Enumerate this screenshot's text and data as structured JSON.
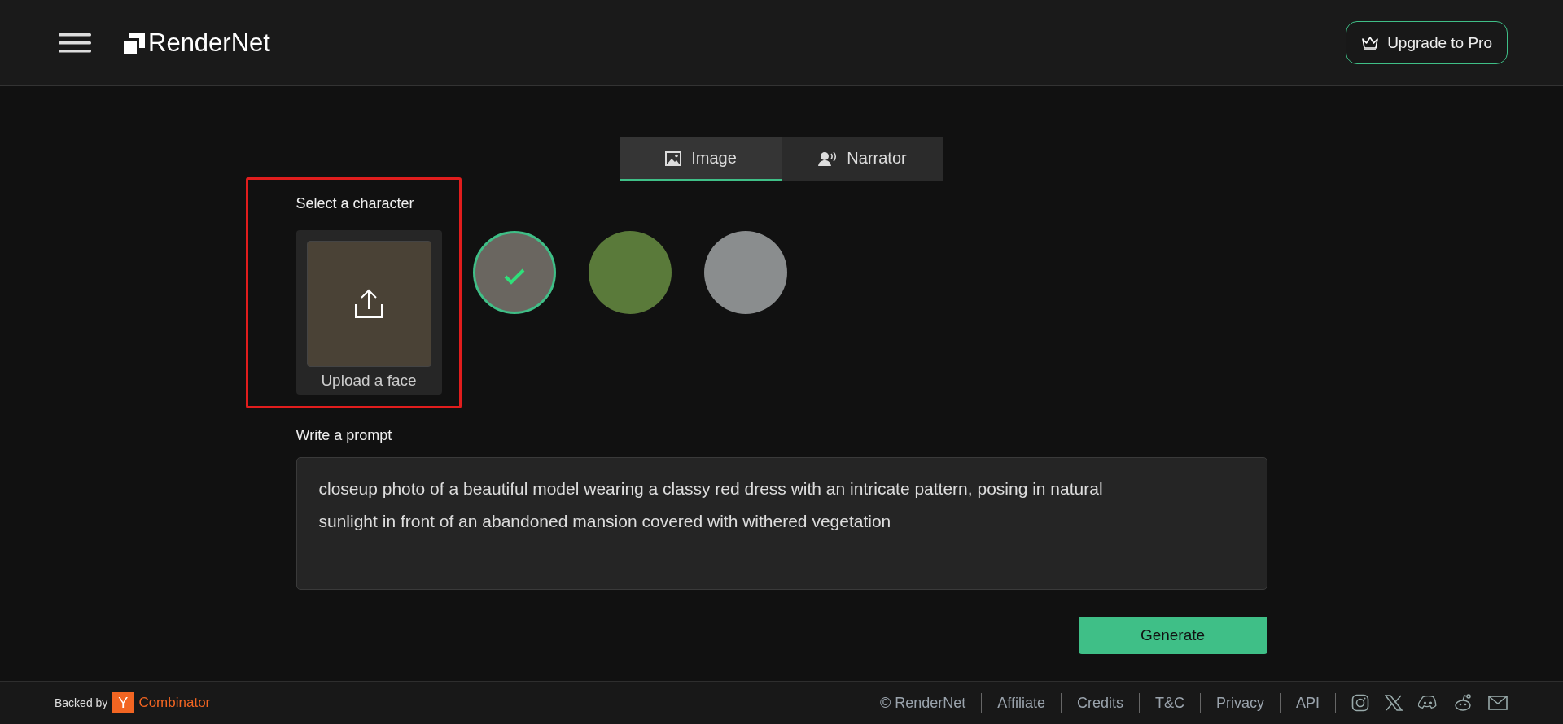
{
  "header": {
    "brand": "RenderNet",
    "upgrade_button": "Upgrade to Pro"
  },
  "tabs": [
    {
      "label": "Image",
      "selected": true
    },
    {
      "label": "Narrator",
      "selected": false
    }
  ],
  "character_section": {
    "label": "Select a character",
    "upload_label": "Upload a face",
    "characters": [
      {
        "selected": true
      },
      {
        "selected": false
      },
      {
        "selected": false
      }
    ]
  },
  "prompt": {
    "label": "Write a prompt",
    "value": "closeup photo of a beautiful model wearing a classy red dress with an intricate pattern, posing in natural sunlight in front of an abandoned mansion covered with withered vegetation"
  },
  "generate_button": "Generate",
  "footer": {
    "backed_by": "Backed by",
    "yc_mark": "Y",
    "yc_name": "Combinator",
    "links": [
      "© RenderNet",
      "Affiliate",
      "Credits",
      "T&C",
      "Privacy",
      "API"
    ]
  }
}
